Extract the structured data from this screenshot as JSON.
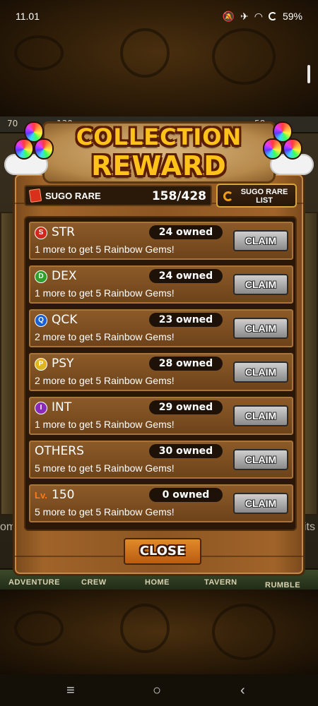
{
  "status_bar": {
    "time": "11.01",
    "battery": "59%",
    "icons": [
      "mute-icon",
      "airplane-icon",
      "wifi-icon",
      "battery-ring-icon"
    ]
  },
  "hud": {
    "left_value": "70",
    "left_value2": "130",
    "right_value": "58"
  },
  "bottom_tabs": [
    "ADVENTURE",
    "CREW",
    "HOME",
    "TAVERN",
    "RUMBLE"
  ],
  "side_clips": {
    "left": "omp",
    "right": "its"
  },
  "modal": {
    "title_line1": "COLLECTION",
    "title_line2": "REWARD",
    "sugo_label": "SUGO RARE",
    "sugo_count": "158/428",
    "sugo_list_line1": "SUGO RARE",
    "sugo_list_line2": "LIST",
    "close_label": "CLOSE",
    "rows": [
      {
        "icon_letter": "S",
        "icon_color": "#d0281c",
        "name": "STR",
        "owned": "24 owned",
        "progress": "1 more to get 5 Rainbow Gems!",
        "button": "CLAIM"
      },
      {
        "icon_letter": "D",
        "icon_color": "#2fa02a",
        "name": "DEX",
        "owned": "24 owned",
        "progress": "1 more to get 5 Rainbow Gems!",
        "button": "CLAIM"
      },
      {
        "icon_letter": "Q",
        "icon_color": "#1c5fd0",
        "name": "QCK",
        "owned": "23 owned",
        "progress": "2 more to get 5 Rainbow Gems!",
        "button": "CLAIM"
      },
      {
        "icon_letter": "P",
        "icon_color": "#e0b41c",
        "name": "PSY",
        "owned": "28 owned",
        "progress": "2 more to get 5 Rainbow Gems!",
        "button": "CLAIM"
      },
      {
        "icon_letter": "I",
        "icon_color": "#8a2ab8",
        "name": "INT",
        "owned": "29 owned",
        "progress": "1 more to get 5 Rainbow Gems!",
        "button": "CLAIM"
      },
      {
        "icon_letter": "",
        "icon_color": "",
        "name": "OTHERS",
        "owned": "30 owned",
        "progress": "5 more to get 5 Rainbow Gems!",
        "button": "CLAIM"
      },
      {
        "lv_prefix": "Lv.",
        "name": "150",
        "owned": "0 owned",
        "progress": "5 more to get 5 Rainbow Gems!",
        "button": "CLAIM"
      }
    ]
  },
  "system_nav": {
    "recent": "≡",
    "home": "○",
    "back": "‹"
  }
}
